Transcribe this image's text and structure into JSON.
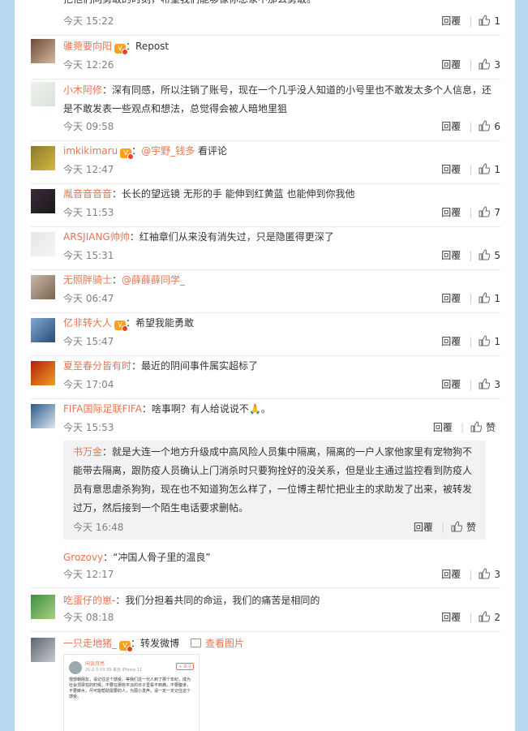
{
  "labels": {
    "reply": "回覆",
    "like_icon": "thumbs-up-icon",
    "view_image": "查看图片",
    "retweet_img": "image-icon"
  },
  "top_partial": {
    "content_fragment": "把他们向勇敢的时刻，希望我们能够像你想象中那么勇敢。",
    "time": "今天 15:22",
    "likes": "1"
  },
  "comments": [
    {
      "user": "骓菀要向阳",
      "badge": true,
      "sep": "：",
      "text": "Repost",
      "time": "今天 12:26",
      "likes": "3"
    },
    {
      "user": "小木阿修",
      "badge": false,
      "sep": "：",
      "text": "深有同感，所以注销了账号，现在一个几乎没人知道的小号里也不敢发太多个人信息，还是不敢发表一些观点和想法，总觉得会被人暗地里狙",
      "time": "今天 09:58",
      "likes": "6"
    },
    {
      "user": "imkikimaru",
      "badge": true,
      "sep": "：",
      "mention": "@宇野_钱多",
      "text": " 看评论",
      "time": "今天 12:47",
      "likes": "1"
    },
    {
      "user": "胤音音音音",
      "badge": false,
      "sep": "：",
      "text": "长长的望远镜 无形的手 能伸到红黄蓝 也能伸到你我他",
      "time": "今天 11:53",
      "likes": "7"
    },
    {
      "user": "ARSJIANG帅帅",
      "badge": false,
      "sep": "：",
      "text": "红袖章们从来没有消失过，只是隐匿得更深了",
      "time": "今天 15:31",
      "likes": "5"
    },
    {
      "user": "无照胖骑士",
      "badge": false,
      "sep": "：",
      "mention": "@薛薛薛同学_",
      "text": "",
      "time": "今天 06:47",
      "likes": "1"
    },
    {
      "user": "亿非转大人",
      "badge": true,
      "sep": "：",
      "text": "希望我能勇敢",
      "time": "今天 15:47",
      "likes": "1"
    },
    {
      "user": "夏至春分皆有时",
      "badge": false,
      "sep": "：",
      "text": "最近的阴间事件属实超标了",
      "time": "今天 17:04",
      "likes": "3"
    },
    {
      "user": "FIFA国际足联FIFA",
      "badge": false,
      "sep": "：",
      "text": "啥事啊？有人给说说不",
      "emoji": "🙏",
      "tail": "。",
      "time": "今天 15:53",
      "likes": "赞"
    }
  ],
  "sub_reply": {
    "user": "书万金",
    "sep": "：",
    "text": "就是大连一个地方升级成中高风险人员集中隔离，隔离的一户人家他家里有宠物狗不能带去隔离，跟防疫人员确认上门消杀时只要狗拴好的没关系，但是业主通过监控看到防疫人员有意思虐杀狗狗，现在也不知道狗怎么样了，一位博主帮忙把业主的求助发了出来，被转发过万，然后接到一个陌生电话要求删帖。",
    "time": "今天 16:48",
    "likes": "赞"
  },
  "after_sub": [
    {
      "user": "Grozovy",
      "badge": false,
      "sep": "：",
      "text": "“冲国人骨子里的温良”",
      "time": "今天 12:17",
      "likes": "3"
    },
    {
      "user": "吃蛋仔的崽-",
      "badge": false,
      "sep": "：",
      "text": "我们分担着共同的命运，我们的痛苦是相同的",
      "time": "今天 08:18",
      "likes": "2"
    },
    {
      "user": "一只走地猪_",
      "badge": true,
      "sep": "：",
      "text": "转发微博",
      "time": "",
      "likes": ""
    }
  ],
  "repost_preview": {
    "author": "闲谈月亮",
    "meta": "20-2-3 03:39 来自 iPhone 11",
    "follow": "+ 关注",
    "body": "憬部朝朋友，请记住这个感受。等我们这一代人到了那个年纪，成为社会顶梁柱的时候，不要在那些平淡的日子里看不到痛，不要腹诽，不要麻木，尽可能帮助需要的人，为弱小发声。请一定一定记住这个感受。"
  }
}
